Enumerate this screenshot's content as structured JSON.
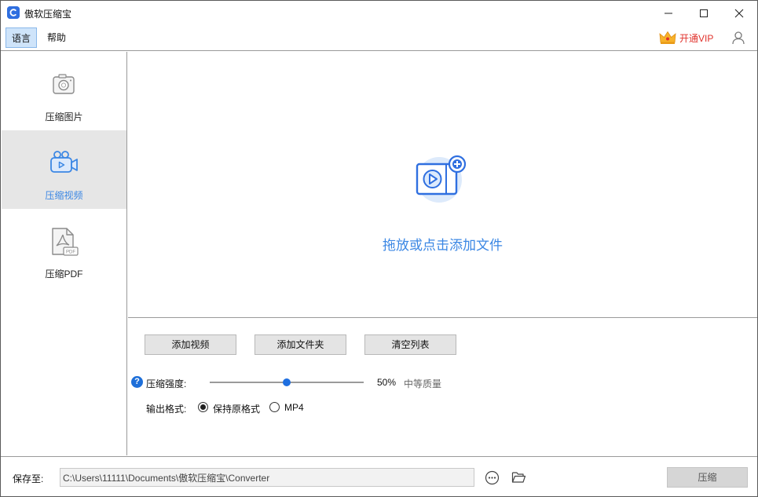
{
  "window": {
    "title": "傲软压缩宝"
  },
  "menu": {
    "language": "语言",
    "help": "帮助",
    "vip": "开通VIP"
  },
  "sidebar": {
    "items": [
      {
        "label": "压缩图片",
        "icon": "camera-icon",
        "active": false
      },
      {
        "label": "压缩视频",
        "icon": "video-camera-icon",
        "active": true
      },
      {
        "label": "压缩PDF",
        "icon": "pdf-file-icon",
        "active": false
      }
    ]
  },
  "dropzone": {
    "text": "拖放或点击添加文件",
    "icon": "add-video-icon"
  },
  "actions": {
    "add_video": "添加视频",
    "add_folder": "添加文件夹",
    "clear_list": "清空列表"
  },
  "compression": {
    "label": "压缩强度:",
    "value_percent": 50,
    "value_text": "50%",
    "quality_text": "中等质量"
  },
  "output_format": {
    "label": "输出格式:",
    "options": [
      {
        "label": "保持原格式",
        "selected": true
      },
      {
        "label": "MP4",
        "selected": false
      }
    ]
  },
  "footer": {
    "save_label": "保存至:",
    "path": "C:\\Users\\11111\\Documents\\傲软压缩宝\\Converter",
    "compress_button": "压缩"
  },
  "colors": {
    "accent": "#3b87e4",
    "vip_text": "#e0312b",
    "active_bg": "#e6e6e6",
    "slider_thumb": "#1f6fe0"
  }
}
